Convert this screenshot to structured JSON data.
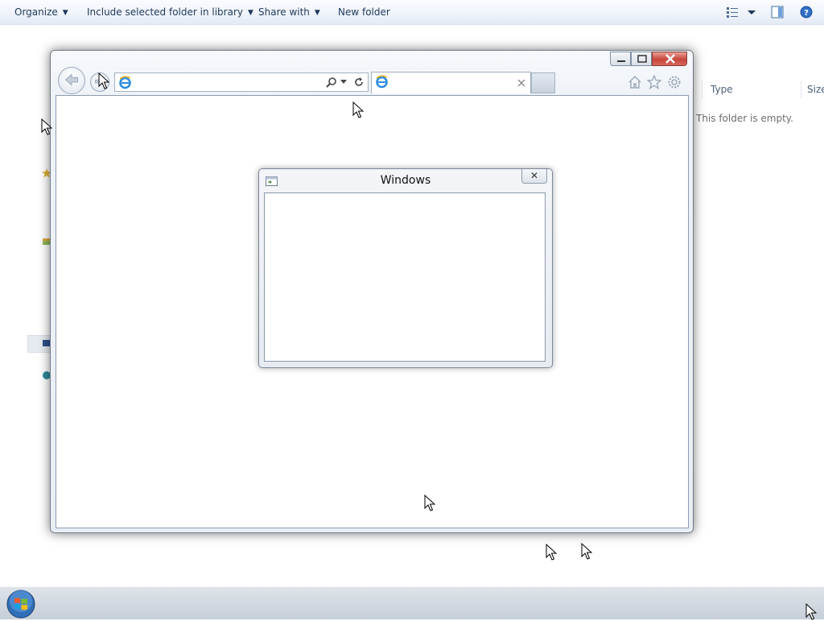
{
  "explorer": {
    "toolbar": {
      "organize": "Organize",
      "include_in_library": "Include selected folder in library",
      "share_with": "Share with",
      "new_folder": "New folder"
    },
    "columns": {
      "type": "Type",
      "size": "Size"
    },
    "empty_message": "This folder is empty."
  },
  "browser": {
    "address_value": "",
    "tab_title": "",
    "icons": [
      "back-icon",
      "forward-icon",
      "search-icon",
      "refresh-icon",
      "home-icon",
      "favorites-star-icon",
      "gear-icon"
    ]
  },
  "dialog": {
    "title": "Windows",
    "close_glyph": "✕"
  },
  "colors": {
    "accent": "#1e395b",
    "close_button_red": "#c7473a",
    "taskbar": "#c6ced8"
  }
}
